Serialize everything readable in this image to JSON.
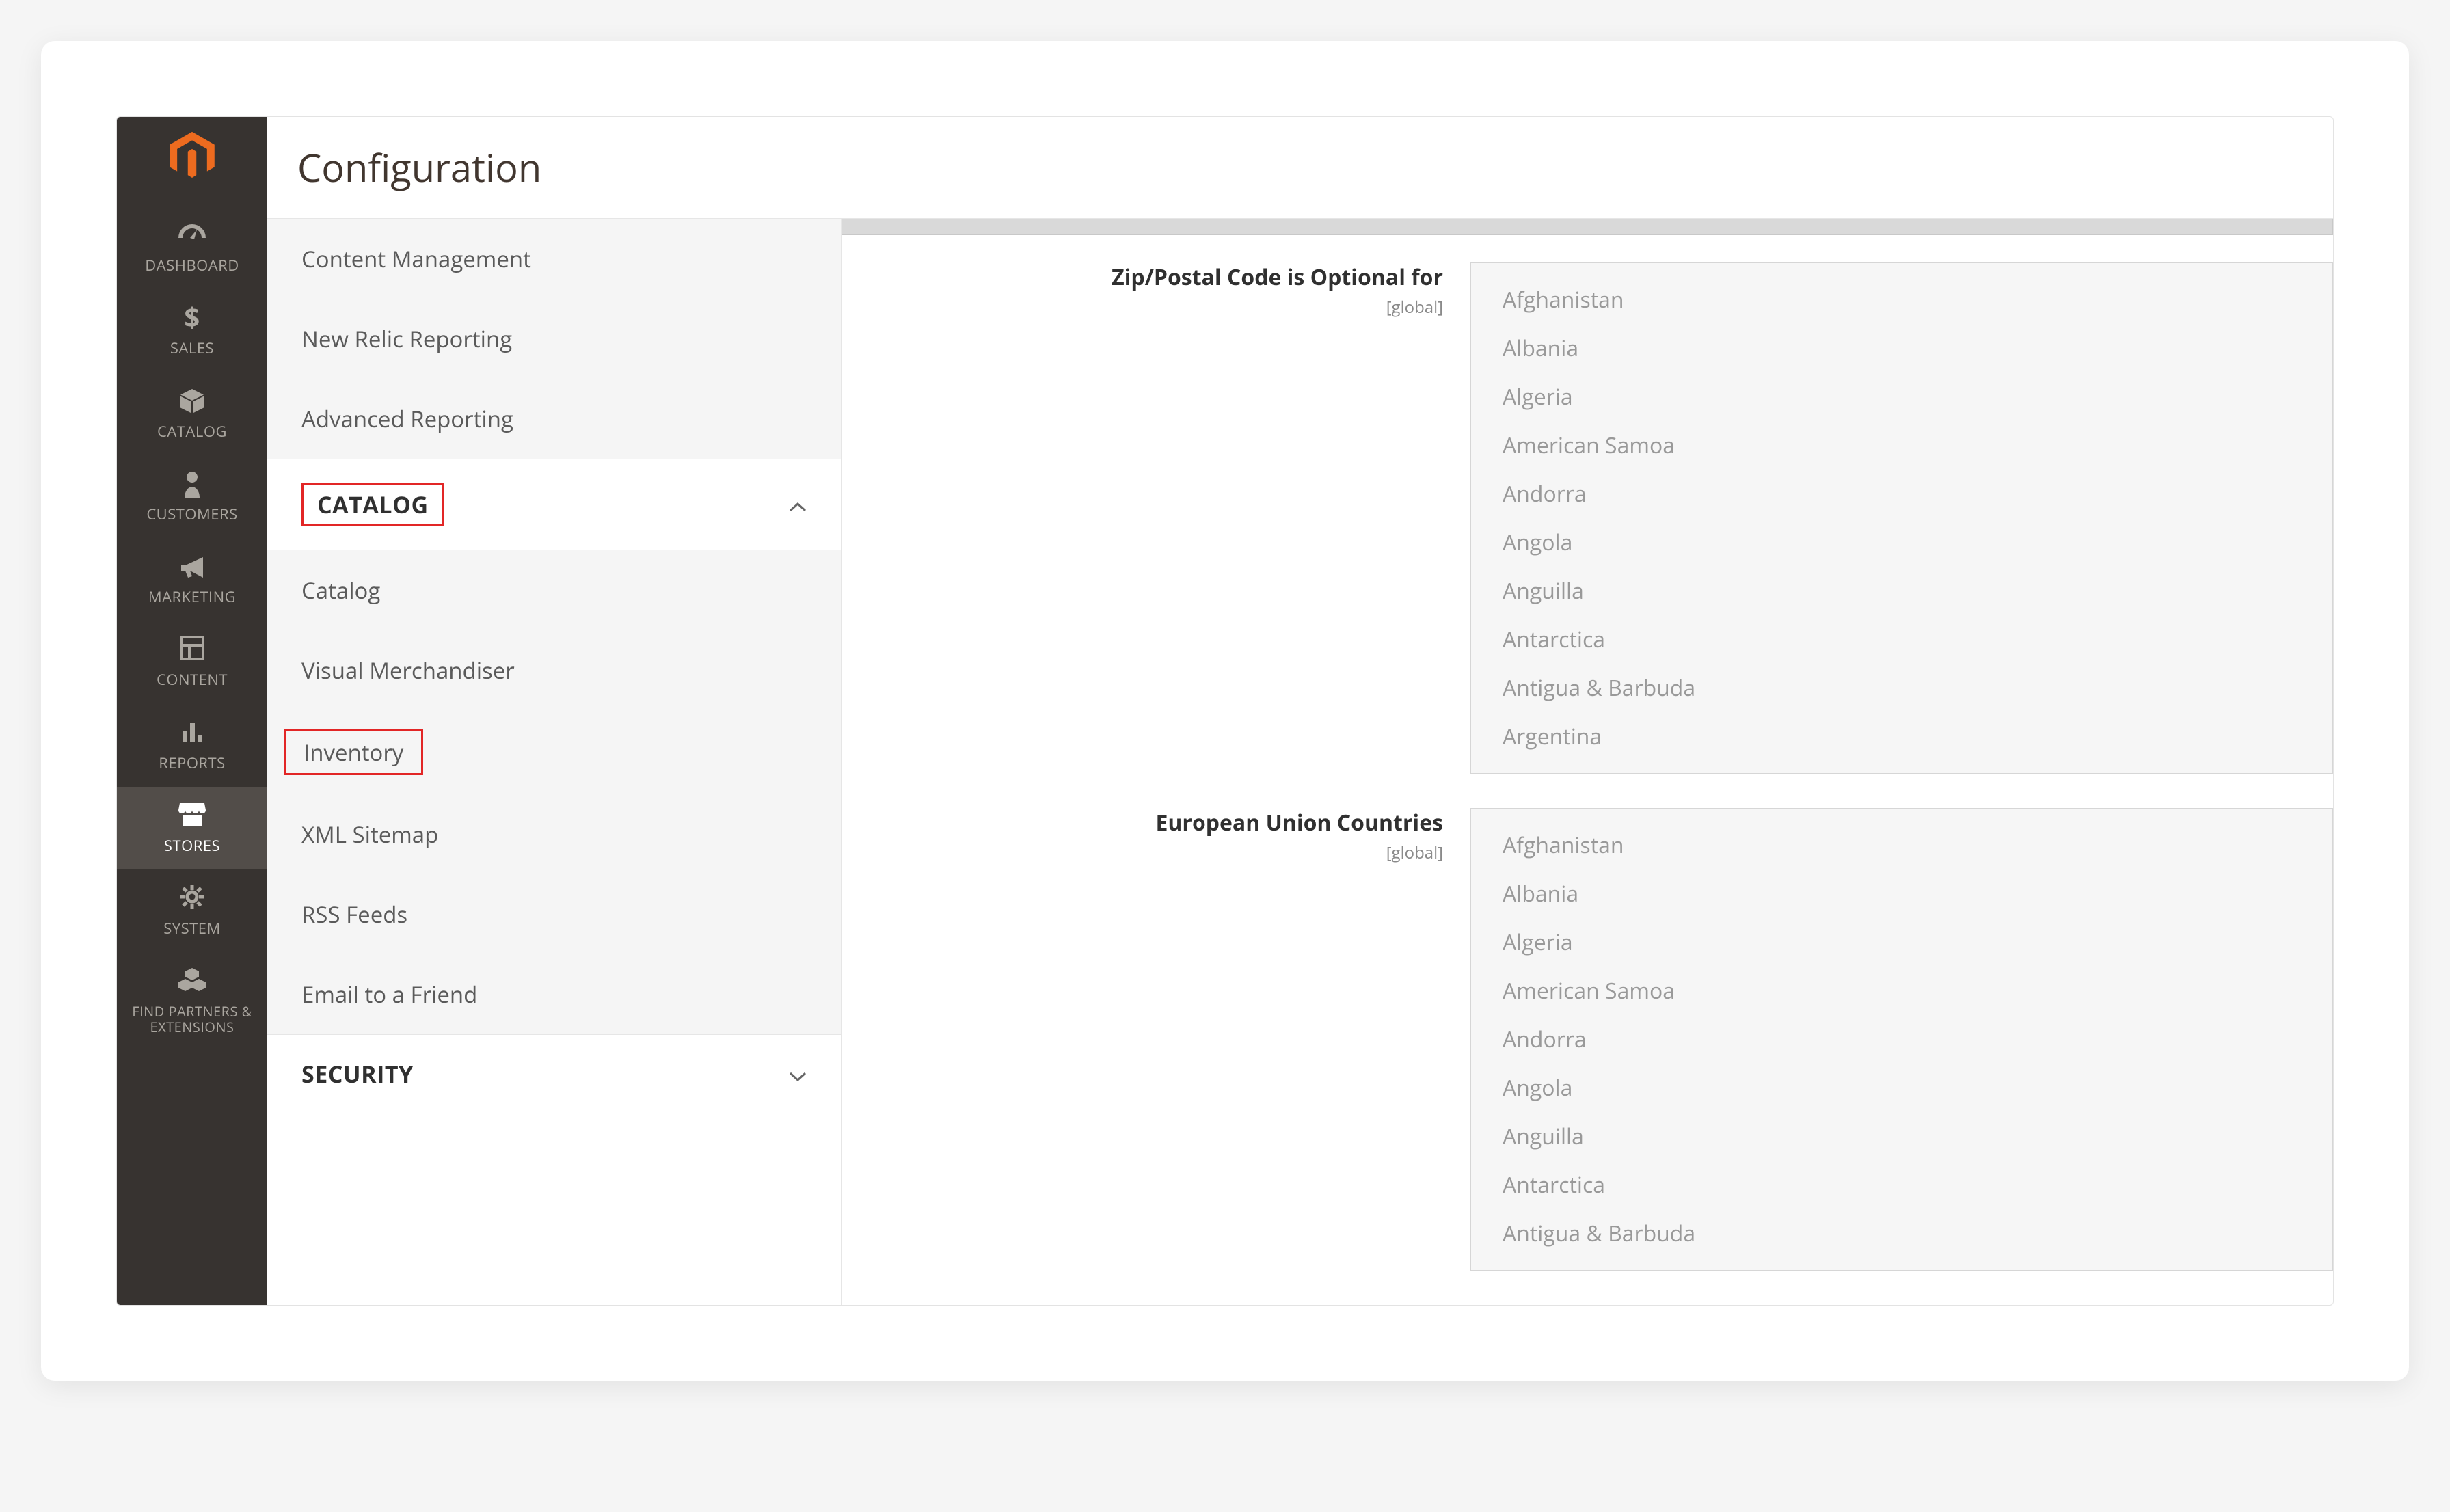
{
  "header": {
    "title": "Configuration"
  },
  "nav": {
    "items": [
      {
        "label": "DASHBOARD"
      },
      {
        "label": "SALES"
      },
      {
        "label": "CATALOG"
      },
      {
        "label": "CUSTOMERS"
      },
      {
        "label": "MARKETING"
      },
      {
        "label": "CONTENT"
      },
      {
        "label": "REPORTS"
      },
      {
        "label": "STORES"
      },
      {
        "label": "SYSTEM"
      },
      {
        "label": "FIND PARTNERS & EXTENSIONS"
      }
    ]
  },
  "config_sidebar": {
    "pre_items": [
      {
        "label": "Content Management"
      },
      {
        "label": "New Relic Reporting"
      },
      {
        "label": "Advanced Reporting"
      }
    ],
    "catalog_section": {
      "title": "CATALOG"
    },
    "catalog_items": [
      {
        "label": "Catalog"
      },
      {
        "label": "Visual Merchandiser"
      },
      {
        "label": "Inventory",
        "boxed": true
      },
      {
        "label": "XML Sitemap"
      },
      {
        "label": "RSS Feeds"
      },
      {
        "label": "Email to a Friend"
      }
    ],
    "security_section": {
      "title": "SECURITY"
    }
  },
  "form": {
    "scope_global": "[global]",
    "rows": [
      {
        "label": "Zip/Postal Code is Optional for",
        "options": [
          "Afghanistan",
          "Albania",
          "Algeria",
          "American Samoa",
          "Andorra",
          "Angola",
          "Anguilla",
          "Antarctica",
          "Antigua & Barbuda",
          "Argentina"
        ]
      },
      {
        "label": "European Union Countries",
        "options": [
          "Afghanistan",
          "Albania",
          "Algeria",
          "American Samoa",
          "Andorra",
          "Angola",
          "Anguilla",
          "Antarctica",
          "Antigua & Barbuda"
        ]
      }
    ]
  }
}
